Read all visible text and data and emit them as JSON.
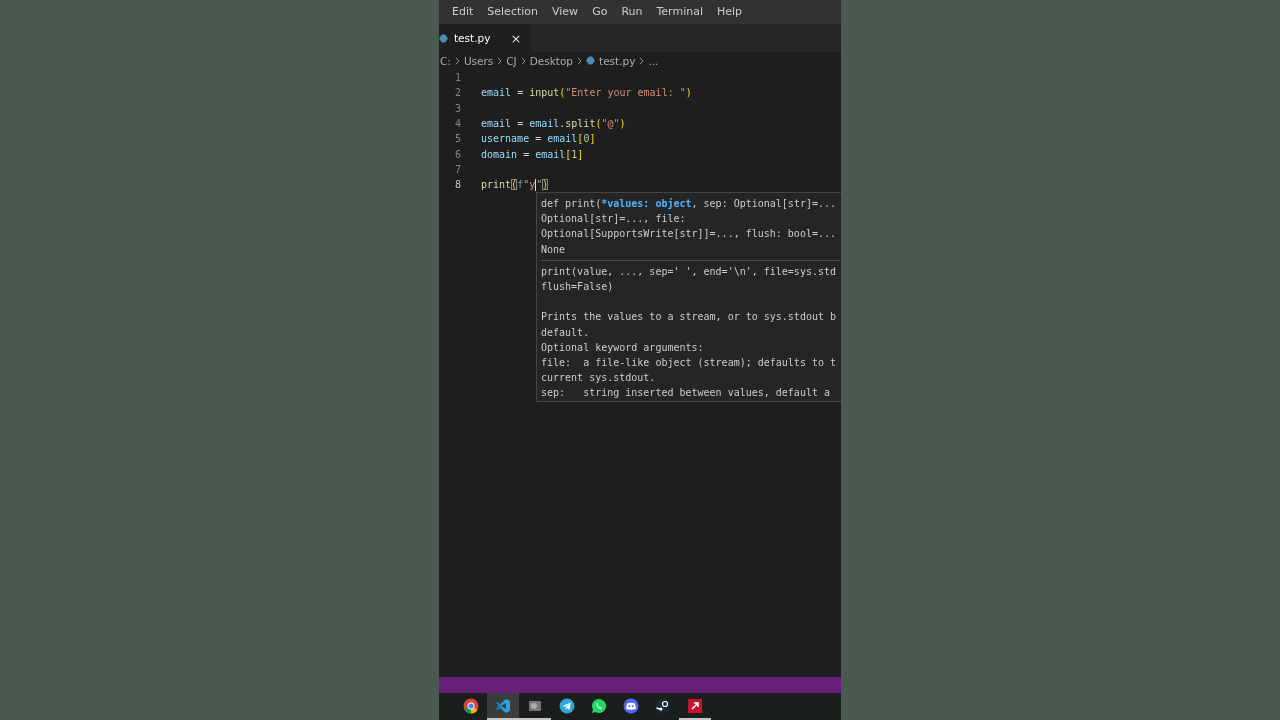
{
  "menu": [
    "Edit",
    "Selection",
    "View",
    "Go",
    "Run",
    "Terminal",
    "Help"
  ],
  "tabs": [
    {
      "label": "test.py",
      "selected": true,
      "close": "×"
    }
  ],
  "breadcrumb": [
    {
      "label": "C:",
      "kind": "text"
    },
    {
      "label": "Users",
      "kind": "text"
    },
    {
      "label": "CJ",
      "kind": "text"
    },
    {
      "label": "Desktop",
      "kind": "text"
    },
    {
      "label": "test.py",
      "kind": "file"
    },
    {
      "label": "...",
      "kind": "text"
    }
  ],
  "code": [
    {
      "number": "1",
      "current": false
    },
    {
      "number": "2",
      "current": false,
      "tokens": [
        {
          "text": "email",
          "kind": "var"
        },
        {
          "text": " = ",
          "kind": "op"
        },
        {
          "text": "input",
          "kind": "func"
        },
        {
          "text": "(",
          "kind": "bracket"
        },
        {
          "text": "\"Enter your email: \"",
          "kind": "str"
        },
        {
          "text": ")",
          "kind": "bracket"
        }
      ]
    },
    {
      "number": "3",
      "current": false
    },
    {
      "number": "4",
      "current": false,
      "tokens": [
        {
          "text": "email",
          "kind": "var"
        },
        {
          "text": " = ",
          "kind": "op"
        },
        {
          "text": "email",
          "kind": "var"
        },
        {
          "text": ".",
          "kind": "op"
        },
        {
          "text": "split",
          "kind": "func"
        },
        {
          "text": "(",
          "kind": "bracket"
        },
        {
          "text": "\"@\"",
          "kind": "str"
        },
        {
          "text": ")",
          "kind": "bracket"
        }
      ]
    },
    {
      "number": "5",
      "current": false,
      "tokens": [
        {
          "text": "username",
          "kind": "var"
        },
        {
          "text": " = ",
          "kind": "op"
        },
        {
          "text": "email",
          "kind": "var"
        },
        {
          "text": "[",
          "kind": "bracket"
        },
        {
          "text": "0",
          "kind": "num"
        },
        {
          "text": "]",
          "kind": "bracket"
        }
      ]
    },
    {
      "number": "6",
      "current": false,
      "tokens": [
        {
          "text": "domain",
          "kind": "var"
        },
        {
          "text": " = ",
          "kind": "op"
        },
        {
          "text": "email",
          "kind": "var"
        },
        {
          "text": "[",
          "kind": "bracket"
        },
        {
          "text": "1",
          "kind": "num"
        },
        {
          "text": "]",
          "kind": "bracket"
        }
      ]
    },
    {
      "number": "7",
      "current": false
    },
    {
      "number": "8",
      "current": true,
      "tokens": [
        {
          "text": "print",
          "kind": "func"
        },
        {
          "text": "(",
          "kind": "bracket",
          "matched": true
        },
        {
          "text": "f",
          "kind": "kw"
        },
        {
          "text": "\"y",
          "kind": "str",
          "cursor_after": true
        },
        {
          "text": "\"",
          "kind": "str"
        },
        {
          "text": ")",
          "kind": "bracket",
          "matched": true
        }
      ]
    }
  ],
  "hover": {
    "signature": [
      [
        {
          "text": "def print(",
          "kind": "plain"
        },
        {
          "text": "*values: object",
          "kind": "param"
        },
        {
          "text": ", sep: Optional[str]=...",
          "kind": "plain"
        }
      ],
      [
        {
          "text": "Optional[str]=..., file:",
          "kind": "plain"
        }
      ],
      [
        {
          "text": "Optional[SupportsWrite[str]]=..., flush: bool=...",
          "kind": "plain"
        }
      ],
      [
        {
          "text": "None",
          "kind": "plain"
        }
      ]
    ],
    "doc": [
      [
        "print(value, ..., sep=' ', end='\\n', file=sys.std",
        "flush=False)"
      ],
      [
        "Prints the values to a stream, or to sys.stdout b",
        "default.",
        "Optional keyword arguments:",
        "file:  a file-like object (stream); defaults to t",
        "current sys.stdout.",
        "sep:   string inserted between values, default a"
      ]
    ]
  },
  "taskbar": [
    {
      "kind": "browser",
      "selected": false,
      "running": false
    },
    {
      "kind": "editor",
      "selected": true,
      "running": true
    },
    {
      "kind": "gallery",
      "selected": false,
      "running": true
    },
    {
      "kind": "plane",
      "selected": false,
      "running": false
    },
    {
      "kind": "phone",
      "selected": false,
      "running": false
    },
    {
      "kind": "controller",
      "selected": false,
      "running": false
    },
    {
      "kind": "steam",
      "selected": false,
      "running": false
    },
    {
      "kind": "tile",
      "selected": false,
      "running": true
    }
  ]
}
